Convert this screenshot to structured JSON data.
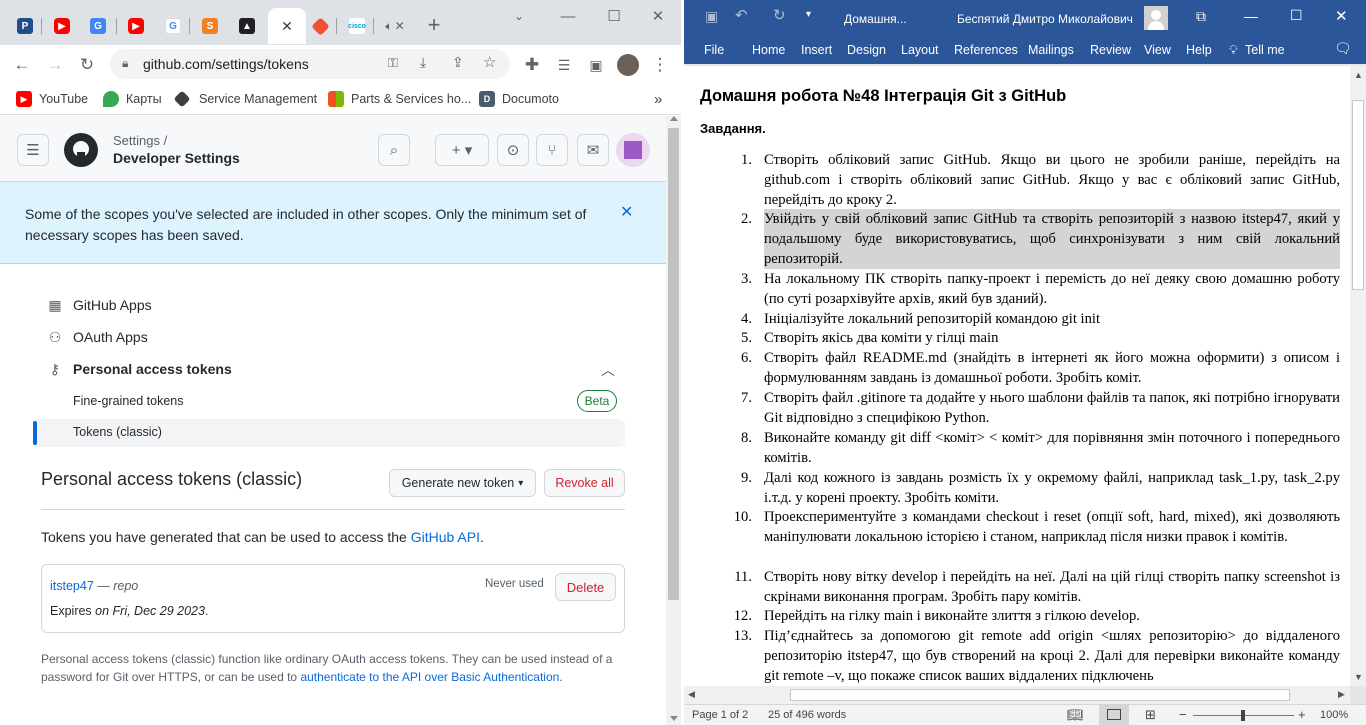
{
  "chrome": {
    "address": "github.com/settings/tokens",
    "bookmarks": [
      "YouTube",
      "Карты",
      "Service Management",
      "Parts & Services ho...",
      "Documoto"
    ]
  },
  "github": {
    "breadcrumb_top": "Settings /",
    "breadcrumb_main": "Developer Settings",
    "flash": "Some of the scopes you've selected are included in other scopes. Only the minimum set of necessary scopes has been saved.",
    "nav": {
      "apps": "GitHub Apps",
      "oauth": "OAuth Apps",
      "pat": "Personal access tokens",
      "fine": "Fine-grained tokens",
      "beta": "Beta",
      "classic": "Tokens (classic)"
    },
    "heading": "Personal access tokens (classic)",
    "generate": "Generate new token",
    "revoke": "Revoke all",
    "intro_text": "Tokens you have generated that can be used to access the ",
    "intro_link": "GitHub API",
    "intro_end": ".",
    "token": {
      "name": "itstep47",
      "dash": " — ",
      "scope": "repo",
      "used": "Never used",
      "delete": "Delete",
      "expires_label": "Expires ",
      "expires_value": "on Fri, Dec 29 2023",
      "expires_end": "."
    },
    "footer_text": "Personal access tokens (classic) function like ordinary OAuth access tokens. They can be used instead of a password for Git over HTTPS, or can be used to ",
    "footer_link": "authenticate to the API over Basic Authentication",
    "footer_end": "."
  },
  "word": {
    "doc_title": "Домашня...",
    "user": "Беспятий Дмитро Миколайович",
    "tabs": [
      "File",
      "Home",
      "Insert",
      "Design",
      "Layout",
      "References",
      "Mailings",
      "Review",
      "View",
      "Help",
      "Tell me"
    ],
    "heading": "Домашня робота №48 Інтеграція Git з GitHub",
    "subheading": "Завдання.",
    "items": [
      {
        "n": "1.",
        "t": "Створіть обліковий запис GitHub. Якщо ви цього не зробили раніше, перейдіть на github.com і створіть обліковий запис GitHub. Якщо у вас є обліковий запис GitHub, перейдіть до кроку 2."
      },
      {
        "n": "2.",
        "t": "Увійдіть у свій обліковий запис GitHub та створіть репозиторій з назвою itstep47, який у подальшому буде використовуватись, щоб синхронізувати з ним свій локальний репозиторій."
      },
      {
        "n": "3.",
        "t": "На локальному ПК створіть папку-проект і перемість до неї деяку свою домашню роботу (по суті розархівуйте архів, який був зданий)."
      },
      {
        "n": "4.",
        "t": "Ініціалізуйте локальний репозиторій командою git init"
      },
      {
        "n": "5.",
        "t": "Створіть якісь два коміти у гілці main"
      },
      {
        "n": "6.",
        "t": " Створіть файл README.md (знайдіть в інтернеті як його можна оформити) з описом і формулюванням завдань із домашньої роботи.  Зробіть коміт."
      },
      {
        "n": "7.",
        "t": "Створіть файл .gitinore та додайте у нього шаблони файлів та папок, які потрібно ігнорувати Git відповідно з специфікою Python."
      },
      {
        "n": "8.",
        "t": "Виконайте команду git diff  <коміт> < коміт> для порівняння змін поточного і попереднього комітів."
      },
      {
        "n": "9.",
        "t": "Далі код кожного із завдань розмість їх у окремому файлі, наприклад  task_1.py, task_2.py і.т.д. у корені проекту. Зробіть коміти."
      },
      {
        "n": "10.",
        "t": "Проекспериментуйте з командами checkout і reset (опції soft, hard, mixed), які дозволяють маніпулювати локальною історією і станом, наприклад після низки правок і комітів."
      },
      {
        "n": "11.",
        "t": "Створіть нову вітку develop і перейдіть на неї. Далі на цій гілці створіть папку screenshot із скрінами виконання програм. Зробіть пару комітів."
      },
      {
        "n": "12.",
        "t": "Перейдіть на гілку main і виконайте злиття з гілкою develop."
      },
      {
        "n": "13.",
        "t": "Під’єднайтесь за допомогою git remote add origin <шлях репозиторію> до віддаленого репозиторію itstep47, що був створений на кроці 2. Далі для перевірки виконайте команду git remote –v, що покаже список ваших віддалених підключень"
      }
    ],
    "status_page": "Page 1 of 2",
    "status_words": "25 of 496 words",
    "zoom": "100%"
  }
}
